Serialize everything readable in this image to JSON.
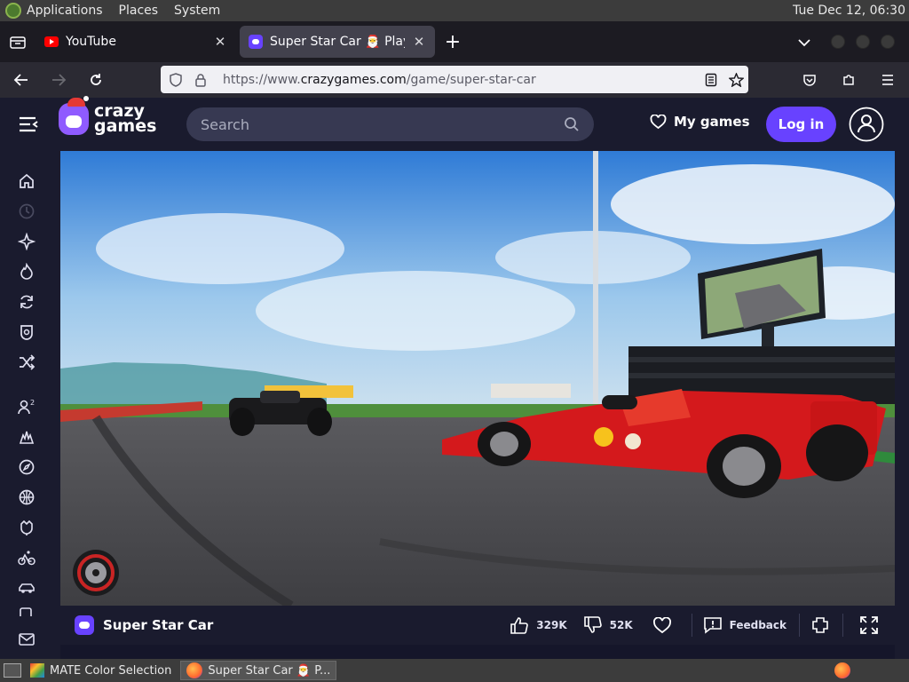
{
  "system_panel": {
    "menus": [
      "Applications",
      "Places",
      "System"
    ],
    "clock": "Tue Dec 12, 06:30"
  },
  "browser": {
    "tabs": [
      {
        "title": "YouTube",
        "active": false,
        "favicon": "youtube-icon"
      },
      {
        "title": "Super Star Car 🎅 Play on Cr",
        "active": true,
        "favicon": "crazygames-icon"
      }
    ],
    "url_prefix": "https://www.",
    "url_host": "crazygames.com",
    "url_path": "/game/super-star-car"
  },
  "site": {
    "logo_line1": "crazy",
    "logo_line2": "games",
    "search_placeholder": "Search",
    "my_games_label": "My games",
    "login_label": "Log in",
    "accent_color": "#6842ff",
    "sidebar_icons": [
      "home-icon",
      "recent-icon",
      "new-icon",
      "hot-icon",
      "updated-icon",
      "originals-icon",
      "random-icon",
      "multiplayer-icon",
      "action-icon",
      "adventure-icon",
      "basketball-icon",
      "casual-icon",
      "bike-icon",
      "car-icon",
      "card-icon",
      "mail-icon"
    ]
  },
  "game": {
    "title": "Super Star Car",
    "likes": "329K",
    "dislikes": "52K",
    "feedback_label": "Feedback"
  },
  "taskbar": {
    "items": [
      {
        "label": "MATE Color Selection",
        "active": false
      },
      {
        "label": "Super Star Car 🎅 P...",
        "active": true
      }
    ]
  }
}
